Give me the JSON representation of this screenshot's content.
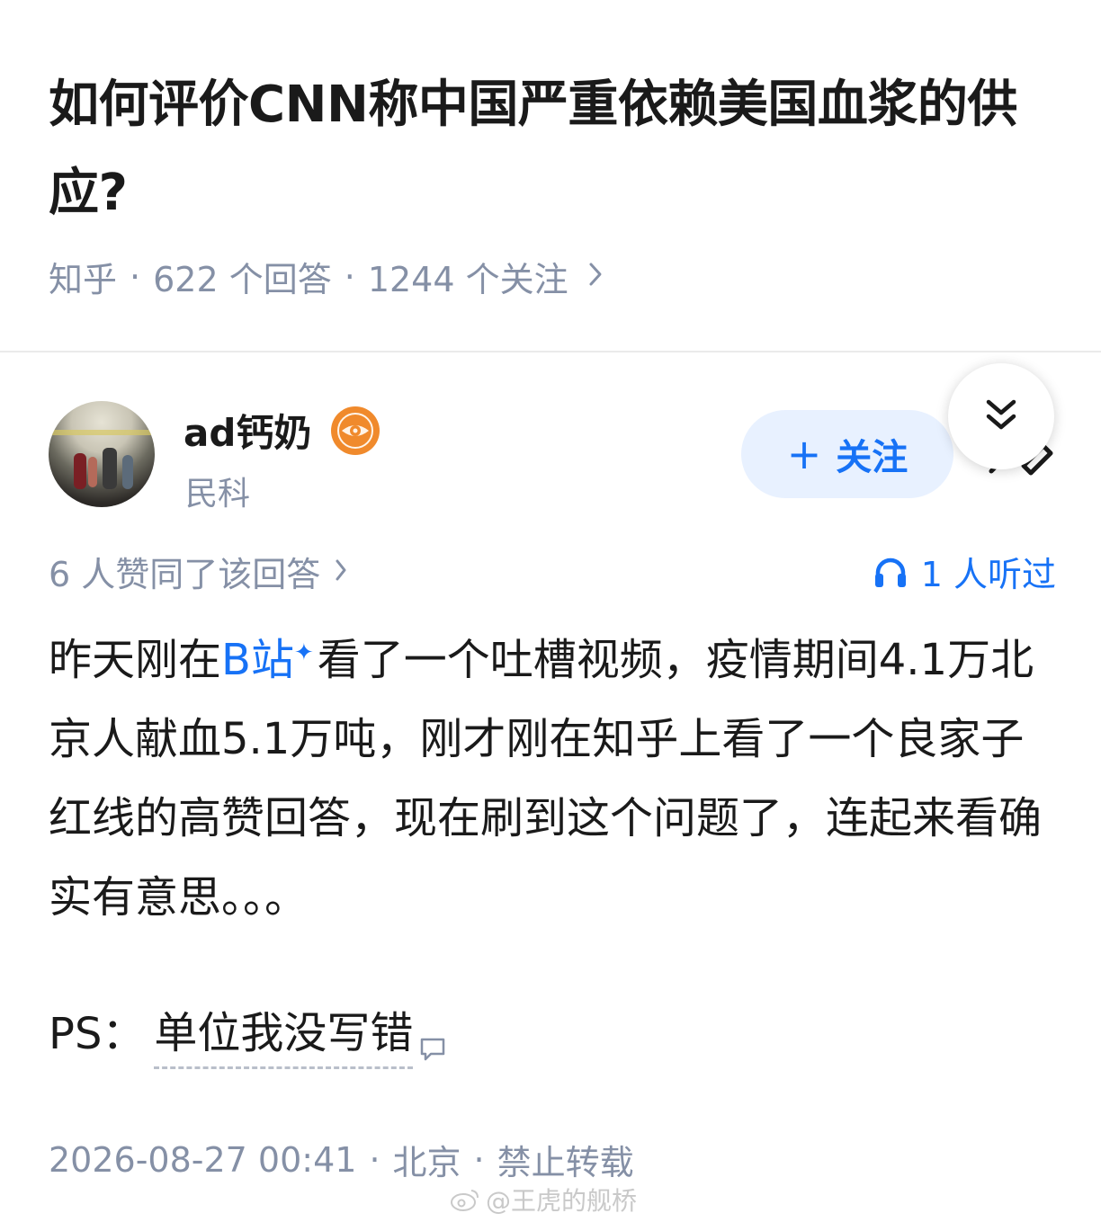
{
  "question": {
    "title": "如何评价CNN称中国严重依赖美国血浆的供应?",
    "source": "知乎",
    "answers": "622 个回答",
    "followers": "1244 个关注"
  },
  "answer": {
    "author_name": "ad钙奶",
    "author_badge_icon": "eye-icon",
    "author_tag": "民科",
    "follow_label": "关注",
    "votes_text": "6 人赞同了该回答",
    "listened_text": "1 人听过",
    "content": {
      "p1_before": "昨天刚在",
      "p1_link": "B站",
      "p1_after": "看了一个吐槽视频，疫情期间4.1万北京人献血5.1万吨，刚才刚在知乎上看了一个良家子红线的高赞回答，现在刷到这个问题了，连起来看确实有意思。。。",
      "ps_prefix": "PS：",
      "ps_annotated": "单位我没写错"
    },
    "date": "2026-08-27 00:41",
    "location": "北京",
    "copyright": "禁止转载"
  },
  "watermark": "@王虎的舰桥",
  "colors": {
    "accent": "#1772f6",
    "meta": "#8590a6",
    "badge": "#f08a2c",
    "follow_bg": "#e8f1ff"
  }
}
